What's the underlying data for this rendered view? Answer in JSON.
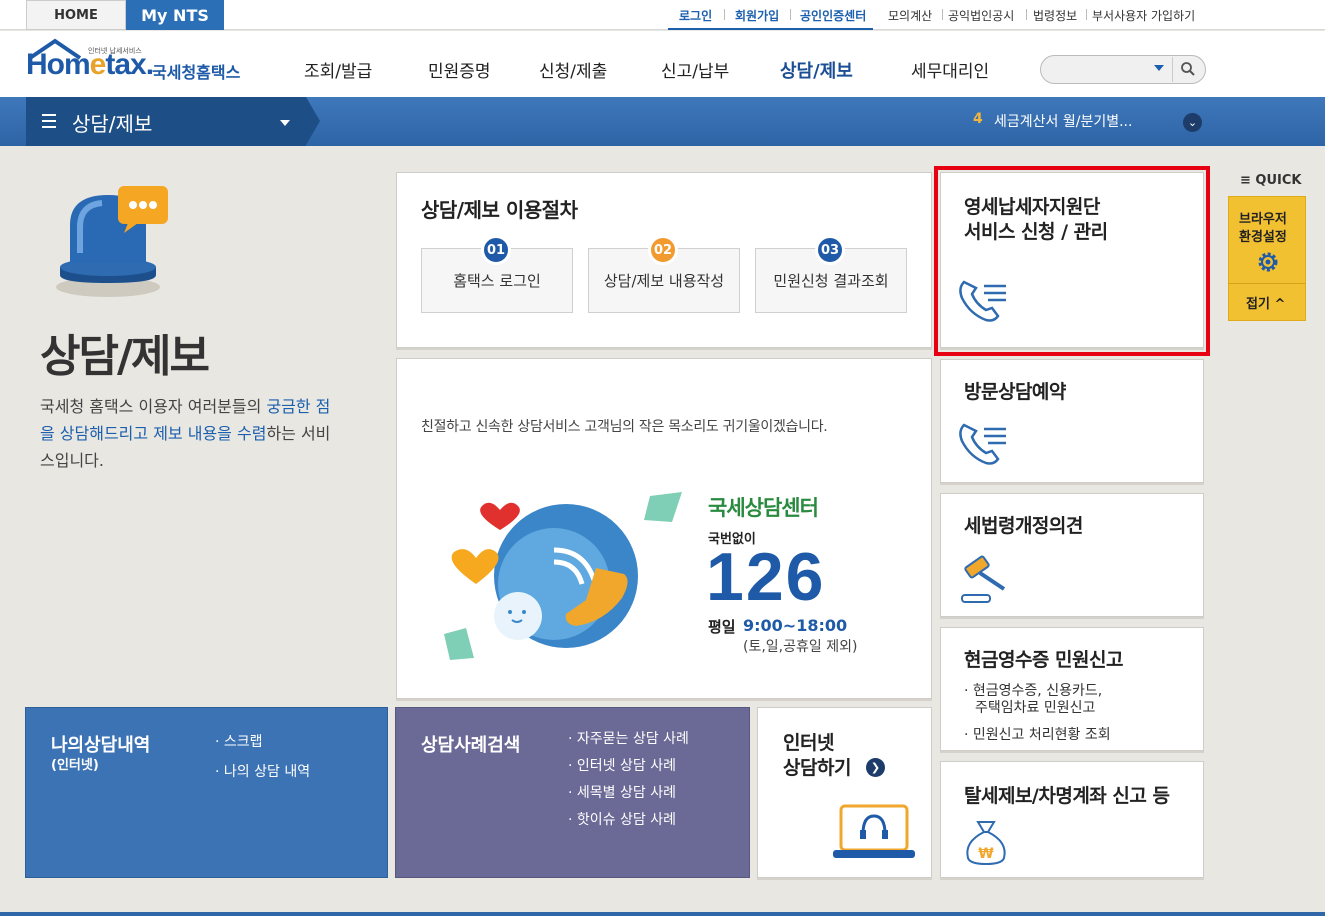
{
  "topbar": {
    "home_tab": "HOME",
    "nts_tab": "My NTS",
    "links": [
      "로그인",
      "회원가입",
      "공인인증센터",
      "모의계산",
      "공익법인공시",
      "법령정보",
      "부서사용자 가입하기"
    ]
  },
  "header": {
    "logo_small": "인터넷 납세서비스",
    "logo_main": "Hom",
    "logo_e": "e",
    "logo_tax": "tax.",
    "logo_kr": "국세청홈택스",
    "nav": [
      "조회/발급",
      "민원증명",
      "신청/제출",
      "신고/납부",
      "상담/제보",
      "세무대리인"
    ],
    "active_nav": "상담/제보"
  },
  "subbar": {
    "menu_title": "상담/제보",
    "notice_num": "4",
    "notice_text": "세금계산서 월/분기별..."
  },
  "intro": {
    "title": "상담/제보",
    "desc_1": "국세청 홈택스 이용자 여러분들의 ",
    "desc_hl1": "궁금한 점을 상담해드리고 제보 내용을 수렴",
    "desc_2": "하는 서비스입니다."
  },
  "procedure": {
    "title": "상담/제보 이용절차",
    "steps": [
      {
        "num": "01",
        "label": "홈택스 로그인",
        "color": "#1e5aa8"
      },
      {
        "num": "02",
        "label": "상담/제보 내용작성",
        "color": "#f29a2e"
      },
      {
        "num": "03",
        "label": "민원신청 결과조회",
        "color": "#1e5aa8"
      }
    ]
  },
  "center": {
    "message": "친절하고 신속한 상담서비스 고객님의 작은 목소리도 귀기울이겠습니다.",
    "brand": "국세상담센터",
    "no_area": "국번없이",
    "number": "126",
    "weekday_label": "평일",
    "hours": "9:00~18:00",
    "except": "(토,일,공휴일 제외)"
  },
  "bottom": {
    "my_history_title": "나의상담내역",
    "my_history_sub": "(인터넷)",
    "my_history_links": [
      "스크랩",
      "나의 상담 내역"
    ],
    "case_search_title": "상담사례검색",
    "case_links": [
      "자주묻는 상담 사례",
      "인터넷 상담 사례",
      "세목별 상담 사례",
      "핫이슈 상담 사례"
    ],
    "internet_title_1": "인터넷",
    "internet_title_2": "상담하기"
  },
  "right": {
    "small_biz_1": "영세납세자지원단",
    "small_biz_2": "서비스 신청 / 관리",
    "visit": "방문상담예약",
    "tax_law": "세법령개정의견",
    "cash_receipt": "현금영수증 민원신고",
    "cash_items": [
      "현금영수증, 신용카드,",
      "주택임차료 민원신고",
      "민원신고 처리현황 조회"
    ],
    "tax_report": "탈세제보/차명계좌 신고 등"
  },
  "quick": {
    "label": "QUICK",
    "browser_1": "브라우저",
    "browser_2": "환경설정",
    "fold": "접기"
  },
  "colors": {
    "brand_blue": "#1e5aa8",
    "highlight_red": "#e60012",
    "quick_yellow": "#f2c132"
  }
}
